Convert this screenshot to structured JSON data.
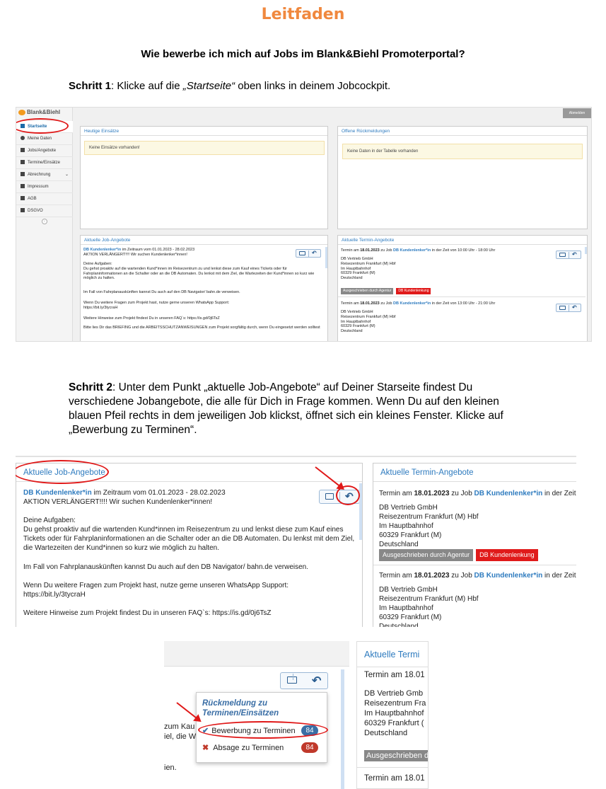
{
  "header": {
    "title": "Leitfaden",
    "question": "Wie bewerbe ich mich auf Jobs im Blank&Biehl Promoterportal?"
  },
  "step1": {
    "label": "Schritt 1",
    "text_a": ": Klicke auf die ",
    "text_em": "„Startseite“",
    "text_b": " oben links in deinem Jobcockpit."
  },
  "step2": {
    "label": "Schritt 2",
    "text": ": Unter dem Punkt „aktuelle Job-Angebote“ auf Deiner Starseite findest Du verschiedene Jobangebote, die alle für Dich in Frage kommen. Wenn Du auf den kleinen blauen Pfeil rechts in dem jeweiligen Job klickst, öffnet sich ein kleines Fenster. Klicke auf „Bewerbung zu Terminen“."
  },
  "portal": {
    "logo": "Blank&Biehl",
    "top_button": "Abmelden",
    "nav": [
      {
        "label": "Startseite"
      },
      {
        "label": "Meine Daten"
      },
      {
        "label": "Jobs/Angebote"
      },
      {
        "label": "Termine/Einsätze"
      },
      {
        "label": "Abrechnung"
      },
      {
        "label": "Impressum"
      },
      {
        "label": "AGB"
      },
      {
        "label": "DSGVO"
      }
    ],
    "panels": {
      "today_title": "Heutige Einsätze",
      "today_empty": "Keine Einsätze vorhanden!",
      "open_title": "Offene Rückmeldungen",
      "open_empty": "Keine Daten in der Tabelle vorhanden",
      "jobs_title": "Aktuelle Job-Angebote",
      "termine_title": "Aktuelle Termin-Angebote"
    },
    "job": {
      "name": "DB Kundenlenker*in",
      "period": " im Zeitraum vom 01.01.2023 - 28.02.2023",
      "line1": "AKTION VERLÄNGERT!!!! Wir suchen Kundenlenker*innen!",
      "line2": "Deine Aufgaben:",
      "line3": "Du gehst proaktiv auf die wartenden Kund*innen im Reisezentrum zu und lenkst diese zum Kauf eines Tickets oder für Fahrplaninformationen an die Schalter oder an die DB Automaten. Du lenkst mit dem Ziel, die Wartezeiten der Kund*innen so kurz wie möglich zu halten.",
      "line4": "Im Fall von Fahrplanauskünften kannst Du auch auf den DB Navigator/ bahn.de verweisen.",
      "line5": "Wenn Du weitere Fragen zum Projekt hast, nutze gerne unseren WhatsApp Support:",
      "line5b": "https://bit.ly/3tycraH",
      "line6": "Weitere Hinweise zum Projekt findest Du in unseren FAQ`s: https://is.gd/0j6TsZ",
      "line7": "Bitte lies Dir das BRIEFING und die ARBEITSSCHUTZANWEISUNGEN zum Projekt sorgfältig durch, wenn Du eingesetzt werden solltest"
    },
    "termin1": {
      "pre": "Termin am ",
      "date": "18.01.2023",
      "mid": " zu Job ",
      "job": "DB Kundenlenker*in",
      "post": " in der Zeit von 10:00 Uhr - 18:00 Uhr",
      "company": "DB Vertrieb GmbH",
      "place": "Reisezentrum Frankfurt (M) Hbf",
      "street": "Im Hauptbahnhof",
      "city": "60329 Frankfurt (M)",
      "country": "Deutschland",
      "tag1": "Ausgeschrieben durch Agentur",
      "tag2": "DB Kundenlenkung"
    },
    "termin2": {
      "pre": "Termin am ",
      "date": "18.01.2023",
      "mid": " zu Job ",
      "job": "DB Kundenlenker*in",
      "post": " in der Zeit von 13:00 Uhr - 21:00 Uhr",
      "post_cut": " in der Zeit von 13:00 Uh",
      "post_cut1": " in der Zeit von 10:00 Uh"
    }
  },
  "zoom": {
    "termine_cut": "Aktuelle Termi",
    "termin_cut": "Termin am 18.01",
    "company_cut": "DB Vertrieb Gmb",
    "place_cut": "Reisezentrum Fra",
    "street": "Im Hauptbahnhof",
    "city_cut": "60329 Frankfurt (",
    "country": "Deutschland",
    "tag_cut": "Ausgeschrieben d",
    "bg1": "zum Kau",
    "bg2": "iel, die W",
    "bg3": "ien."
  },
  "menu": {
    "heading": "Rückmeldung zu Terminen/Einsätzen",
    "apply_label": "Bewerbung zu Terminen",
    "apply_count": "84",
    "cancel_label": "Absage zu Terminen",
    "cancel_count": "84"
  },
  "colors": {
    "title": "#f0883e",
    "link_blue": "#2e7bbf",
    "highlight_red": "#e01818",
    "tag_red": "#e01a1a",
    "tag_gray": "#888888",
    "badge_blue": "#3a6ea5",
    "badge_red": "#c0392b"
  }
}
